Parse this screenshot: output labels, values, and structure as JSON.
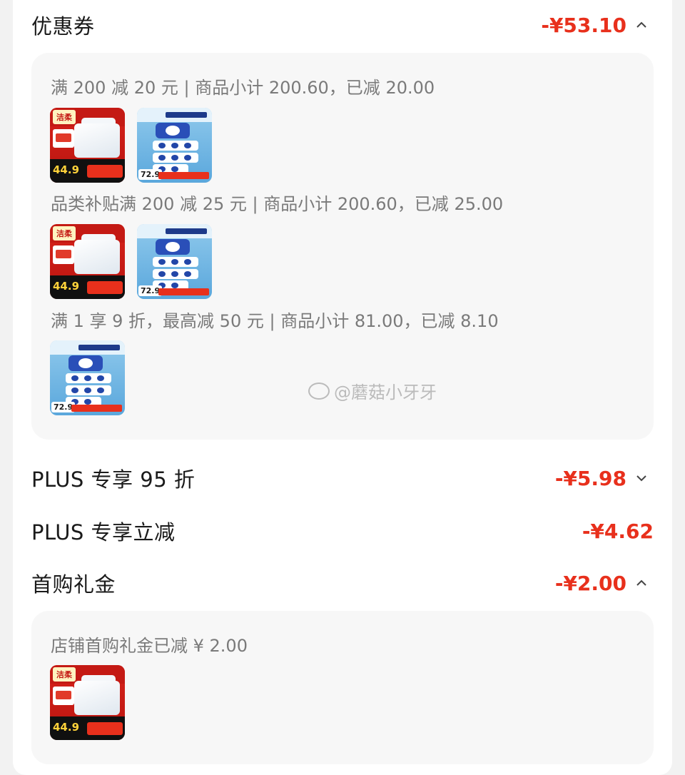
{
  "coupon": {
    "label": "优惠券",
    "amount": "-¥53.10",
    "rules": [
      {
        "text": "满 200 减 20 元 | 商品小计 200.60，已减 20.00",
        "products": [
          "jieyou-tissue",
          "beiyou-wipes"
        ]
      },
      {
        "text": "品类补贴满 200 减 25 元 | 商品小计 200.60，已减 25.00",
        "products": [
          "jieyou-tissue",
          "beiyou-wipes"
        ]
      },
      {
        "text": "满 1 享 9 折，最高减 50 元 | 商品小计 81.00，已减 8.10",
        "products": [
          "beiyou-wipes"
        ]
      }
    ]
  },
  "plus_discount": {
    "label": "PLUS 专享 95 折",
    "amount": "-¥5.98"
  },
  "plus_instant": {
    "label": "PLUS 专享立减",
    "amount": "-¥4.62"
  },
  "first_purchase": {
    "label": "首购礼金",
    "amount": "-¥2.00",
    "rule": {
      "text": "店铺首购礼金已减 ¥ 2.00",
      "products": [
        "jieyou-tissue"
      ]
    }
  },
  "watermark": "@蘑菇小牙牙",
  "colors": {
    "accent": "#e8301c",
    "panel": "#f7f7f7",
    "muted": "#7a7a7a"
  }
}
